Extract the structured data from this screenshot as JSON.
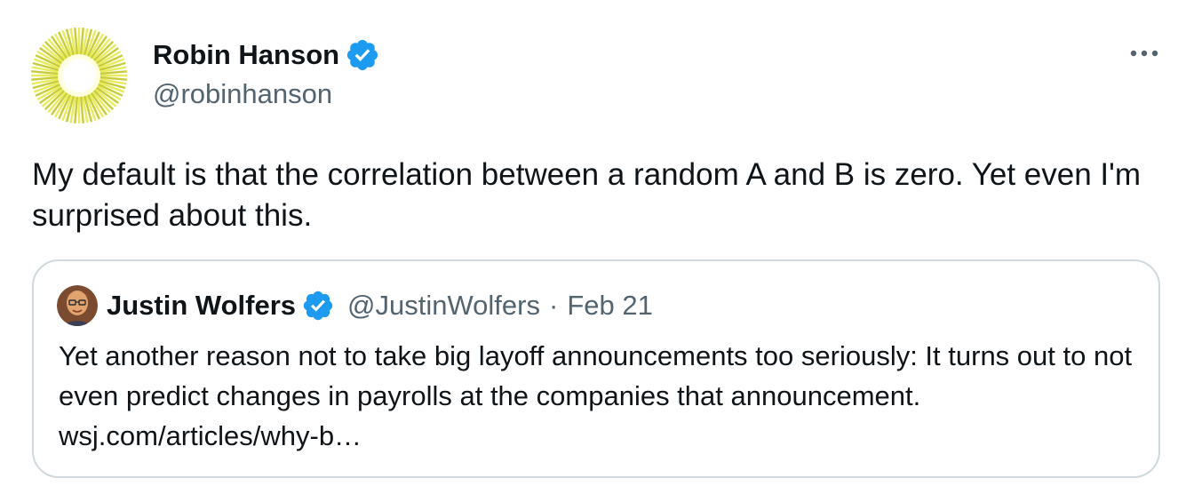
{
  "tweet": {
    "author_name": "Robin Hanson",
    "author_handle": "@robinhanson",
    "avatar_icon": "sunburst-avatar-icon",
    "verified_icon": "verified-badge-icon",
    "more_icon": "more-options-icon",
    "text": "My default is that the correlation between a random A and B is zero. Yet even I'm surprised about this."
  },
  "quoted_tweet": {
    "author_name": "Justin Wolfers",
    "author_handle": "@JustinWolfers",
    "separator": "·",
    "date": "Feb 21",
    "avatar_icon": "profile-photo-avatar-icon",
    "verified_icon": "verified-badge-icon",
    "text": "Yet another reason not to take big layoff announcements too seriously: It turns out to not even predict changes in payrolls at the companies that announcement. wsj.com/articles/why-b…"
  },
  "colors": {
    "text_primary": "#0f1419",
    "text_secondary": "#536471",
    "verified_blue": "#1d9bf0",
    "border": "#cfd9de",
    "avatar_sun": "#e8ec5a"
  }
}
